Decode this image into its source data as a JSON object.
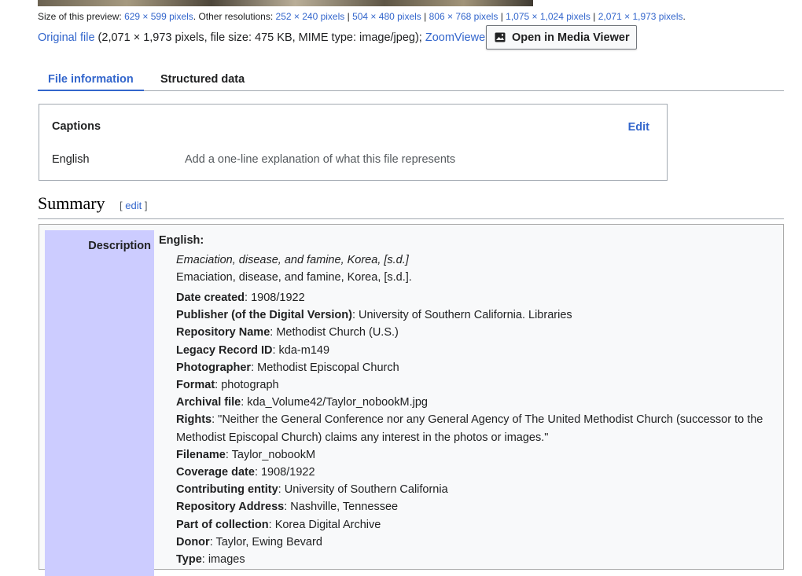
{
  "preview": {
    "label": "Size of this preview:",
    "current": "629 × 599 pixels",
    "other_label": ". Other resolutions:",
    "resolutions": [
      "252 × 240 pixels",
      "504 × 480 pixels",
      "806 × 768 pixels",
      "1,075 × 1,024 pixels",
      "2,071 × 1,973 pixels"
    ],
    "end": "."
  },
  "original": {
    "link": "Original file",
    "info": " (2,071 × 1,973 pixels, file size: 475 KB, MIME type: image/jpeg); ",
    "zoom_link": "ZoomViewer"
  },
  "media_viewer_button": {
    "label": "Open in Media Viewer",
    "icon": "image-icon"
  },
  "tabs": [
    {
      "label": "File information",
      "active": true
    },
    {
      "label": "Structured data",
      "active": false
    }
  ],
  "captions": {
    "title": "Captions",
    "edit": "Edit",
    "language": "English",
    "placeholder": "Add a one-line explanation of what this file represents"
  },
  "summary": {
    "title": "Summary",
    "edit_open": "[ ",
    "edit_link": "edit",
    "edit_close": " ]"
  },
  "info": {
    "description_label": "Description",
    "language": "English:",
    "italic_title": "Emaciation, disease, and famine, Korea, [s.d.]",
    "plain_title": "Emaciation, disease, and famine, Korea, [s.d.].",
    "fields": [
      {
        "key": "Date created",
        "value": ": 1908/1922"
      },
      {
        "key": "Publisher (of the Digital Version)",
        "value": ": University of Southern California. Libraries"
      },
      {
        "key": "Repository Name",
        "value": ": Methodist Church (U.S.)"
      },
      {
        "key": "Legacy Record ID",
        "value": ": kda-m149"
      },
      {
        "key": "Photographer",
        "value": ": Methodist Episcopal Church"
      },
      {
        "key": "Format",
        "value": ": photograph"
      },
      {
        "key": "Archival file",
        "value": ": kda_Volume42/Taylor_nobookM.jpg"
      },
      {
        "key": "Rights",
        "value": ": \"Neither the General Conference nor any General Agency of The United Methodist Church (successor to the Methodist Episcopal Church) claims any interest in the photos or images.\""
      },
      {
        "key": "Filename",
        "value": ": Taylor_nobookM"
      },
      {
        "key": "Coverage date",
        "value": ": 1908/1922"
      },
      {
        "key": "Contributing entity",
        "value": ": University of Southern California"
      },
      {
        "key": "Repository Address",
        "value": ": Nashville, Tennessee"
      },
      {
        "key": "Part of collection",
        "value": ": Korea Digital Archive"
      },
      {
        "key": "Donor",
        "value": ": Taylor, Ewing Bevard"
      },
      {
        "key": "Type",
        "value": ": images"
      }
    ]
  },
  "colors": {
    "link": "#3366cc",
    "label_cell": "#ccccff",
    "border": "#a2a9b1"
  }
}
